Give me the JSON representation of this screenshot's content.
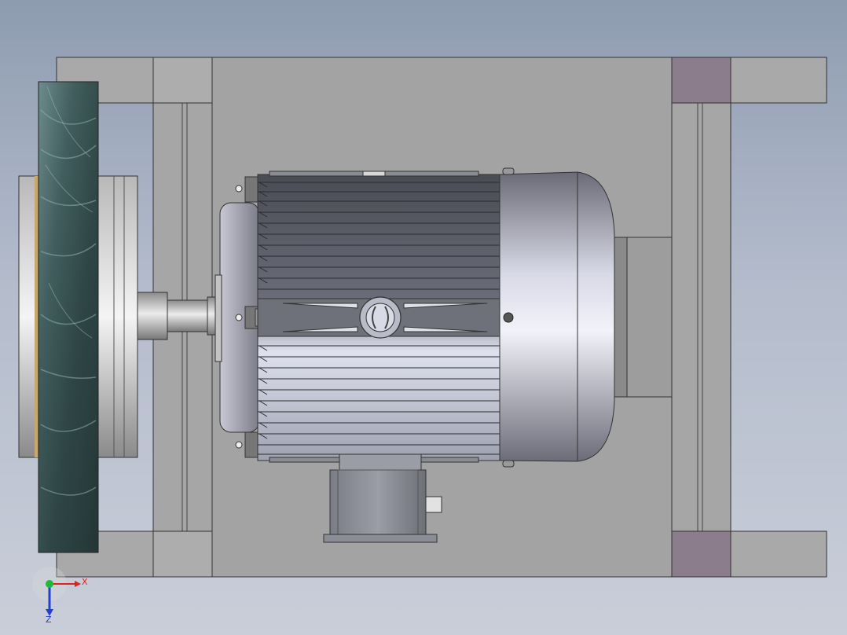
{
  "viewport": {
    "background_top": "#8e9cb0",
    "background_bottom": "#c9ced9"
  },
  "model": {
    "parts": [
      "frame-base",
      "electric-motor",
      "grinding-wheel",
      "shaft",
      "terminal-box"
    ],
    "colors": {
      "frame": "#a9a9a9",
      "frame_dark": "#8c8c8c",
      "mount_pad": "#8c7d8c",
      "motor_body": "#5d5f68",
      "motor_highlight": "#e6e8f4",
      "wheel": "#3f5a58"
    }
  },
  "triad": {
    "x_label": "X",
    "z_label": "Z",
    "x_color": "#e0201a",
    "y_color": "#1fb83a",
    "z_color": "#2040d0"
  }
}
